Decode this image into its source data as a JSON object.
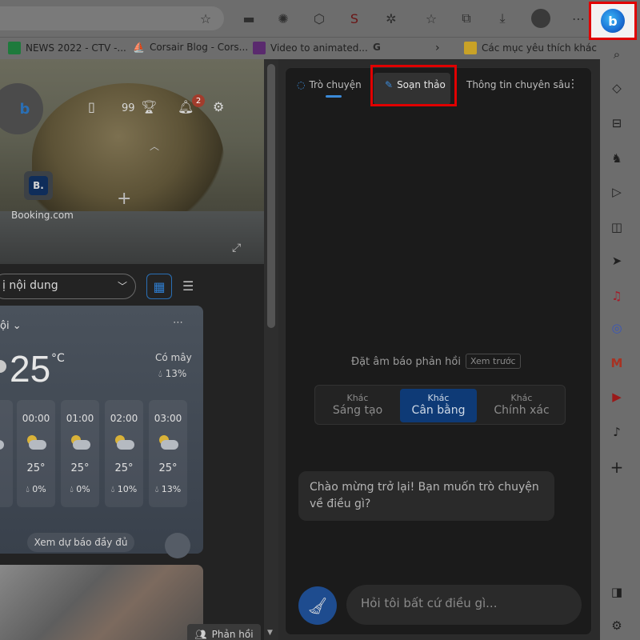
{
  "toolbar": {
    "icons": [
      "star-plus-icon",
      "extension-icon",
      "settings-gear-icon",
      "color-extension-icon",
      "s-extension-icon",
      "puzzle-icon",
      "favorites-icon",
      "collections-icon",
      "download-icon",
      "profile-avatar",
      "more-icon"
    ]
  },
  "bookmarks": [
    {
      "label": "NEWS 2022 - CTV -...",
      "color": "#1e7a3c"
    },
    {
      "label": "Corsair Blog - Cors...",
      "color": "#1c1c1c"
    },
    {
      "label": "Video to animated...",
      "color": "#5a2a6e"
    },
    {
      "label": "G",
      "color": "#6d6d6d"
    },
    {
      "label": "Các mục yêu thích khác",
      "color": "#c9a227"
    }
  ],
  "page": {
    "notifications_count": "2",
    "rewards_points": "99",
    "booking_tile_letter": "B.",
    "booking_label": "Booking.com",
    "feed_select": "ị nội dung",
    "weather": {
      "city": "ội",
      "temp": "25",
      "unit": "°C",
      "condition": "Có mây",
      "precip": "13%",
      "hours": [
        {
          "time": "00:00",
          "deg": "25°",
          "p": "0%"
        },
        {
          "time": "01:00",
          "deg": "25°",
          "p": "0%"
        },
        {
          "time": "02:00",
          "deg": "25°",
          "p": "10%"
        },
        {
          "time": "03:00",
          "deg": "25°",
          "p": "13%"
        }
      ],
      "forecast_button": "Xem dự báo đầy đủ"
    },
    "feedback_label": "Phản hồi"
  },
  "panel": {
    "tabs": [
      "Trò chuyện",
      "Soạn thảo",
      "Thông tin chuyên sâu"
    ],
    "active_tab": "Soạn thảo",
    "tone_label": "Đặt âm báo phản hồi",
    "preview_chip": "Xem trước",
    "tones": [
      {
        "top": "Khác",
        "bottom": "Sáng tạo"
      },
      {
        "top": "Khác",
        "bottom": "Cân bằng"
      },
      {
        "top": "Khác",
        "bottom": "Chính xác"
      }
    ],
    "greeting": "Chào mừng trở lại! Bạn muốn trò chuyện về điều gì?",
    "ask_placeholder": "Hỏi tôi bất cứ điều gì..."
  },
  "sidebar": {
    "bing_letter": "b",
    "icons": [
      "search-icon",
      "tag-icon",
      "toolbox-icon",
      "games-icon",
      "office-icon",
      "outlook-icon",
      "telegram-icon",
      "music-icon",
      "messenger-icon",
      "gmail-icon",
      "youtube-icon",
      "tiktok-icon",
      "add-icon",
      "split-screen-icon",
      "settings-icon"
    ]
  },
  "colors": {
    "accent": "#1e6fd4",
    "highlight": "#e00000"
  }
}
